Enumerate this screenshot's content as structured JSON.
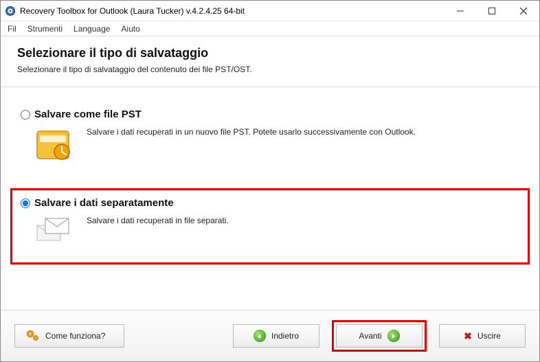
{
  "window": {
    "title": "Recovery Toolbox for Outlook (Laura Tucker) v.4.2.4.25 64-bit"
  },
  "menu": {
    "file": "Fil",
    "tools": "Strumenti",
    "language": "Language",
    "help": "Aiuto"
  },
  "header": {
    "title": "Selezionare il tipo di salvataggio",
    "subtitle": "Selezionare il tipo di salvataggio del contenuto dei file PST/OST."
  },
  "options": {
    "pst": {
      "label": "Salvare come file PST",
      "description": "Salvare i dati recuperati in un nuovo file PST. Potete usarlo successivamente con Outlook."
    },
    "separate": {
      "label": "Salvare i dati separatamente",
      "description": "Salvare i dati recuperati in file separati."
    }
  },
  "footer": {
    "how": "Come funziona?",
    "back": "Indietro",
    "next": "Avanti",
    "exit": "Uscire"
  }
}
